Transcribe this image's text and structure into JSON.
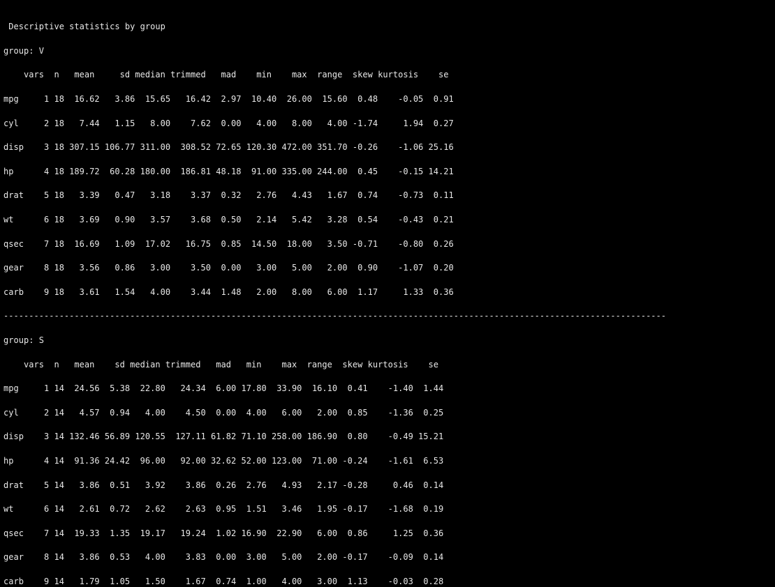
{
  "title": " Descriptive statistics by group",
  "groups": [
    {
      "label": "group: V",
      "header": "    vars  n   mean     sd median trimmed   mad    min    max  range  skew kurtosis    se",
      "rows": [
        "mpg     1 18  16.62   3.86  15.65   16.42  2.97  10.40  26.00  15.60  0.48    -0.05  0.91",
        "cyl     2 18   7.44   1.15   8.00    7.62  0.00   4.00   8.00   4.00 -1.74     1.94  0.27",
        "disp    3 18 307.15 106.77 311.00  308.52 72.65 120.30 472.00 351.70 -0.26    -1.06 25.16",
        "hp      4 18 189.72  60.28 180.00  186.81 48.18  91.00 335.00 244.00  0.45    -0.15 14.21",
        "drat    5 18   3.39   0.47   3.18    3.37  0.32   2.76   4.43   1.67  0.74    -0.73  0.11",
        "wt      6 18   3.69   0.90   3.57    3.68  0.50   2.14   5.42   3.28  0.54    -0.43  0.21",
        "qsec    7 18  16.69   1.09  17.02   16.75  0.85  14.50  18.00   3.50 -0.71    -0.80  0.26",
        "gear    8 18   3.56   0.86   3.00    3.50  0.00   3.00   5.00   2.00  0.90    -1.07  0.20",
        "carb    9 18   3.61   1.54   4.00    3.44  1.48   2.00   8.00   6.00  1.17     1.33  0.36"
      ]
    },
    {
      "label": "group: S",
      "header": "    vars  n   mean    sd median trimmed   mad   min    max  range  skew kurtosis    se",
      "rows": [
        "mpg     1 14  24.56  5.38  22.80   24.34  6.00 17.80  33.90  16.10  0.41    -1.40  1.44",
        "cyl     2 14   4.57  0.94   4.00    4.50  0.00  4.00   6.00   2.00  0.85    -1.36  0.25",
        "disp    3 14 132.46 56.89 120.55  127.11 61.82 71.10 258.00 186.90  0.80    -0.49 15.21",
        "hp      4 14  91.36 24.42  96.00   92.00 32.62 52.00 123.00  71.00 -0.24    -1.61  6.53",
        "drat    5 14   3.86  0.51   3.92    3.86  0.26  2.76   4.93   2.17 -0.28     0.46  0.14",
        "wt      6 14   2.61  0.72   2.62    2.63  0.95  1.51   3.46   1.95 -0.17    -1.68  0.19",
        "qsec    7 14  19.33  1.35  19.17   19.24  1.02 16.90  22.90   6.00  0.86     1.25  0.36",
        "gear    8 14   3.86  0.53   4.00    3.83  0.00  3.00   5.00   2.00 -0.17    -0.09  0.14",
        "carb    9 14   1.79  1.05   1.50    1.67  0.74  1.00   4.00   3.00  1.13    -0.03  0.28"
      ]
    }
  ],
  "separator": "-----------------------------------------------------------------------------------------------------------------------------------"
}
